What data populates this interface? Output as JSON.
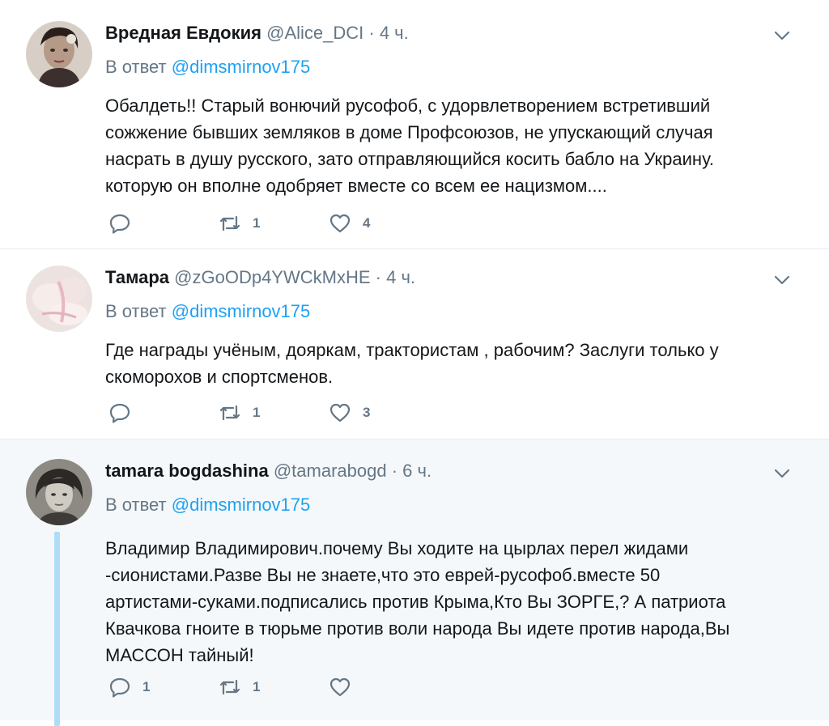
{
  "tweets": [
    {
      "name": "Вредная Евдокия",
      "handle": "@Alice_DCI",
      "dot": "·",
      "time": "4 ч.",
      "reply_prefix": "В ответ",
      "reply_to": "@dimsmirnov175",
      "text": "Обалдеть!! Старый вонючий русофоб, с удорвлетворением встретивший\nсожжение бывших земляков в доме Профсоюзов, не упускающий случая\nнасрать в душу русского, зато отправляющийся косить бабло на Украину.\nкоторую он вполне одобряет вместе со всем ее нацизмом....",
      "replies": "",
      "retweets": "1",
      "likes": "4"
    },
    {
      "name": "Тамара",
      "handle": "@zGoODp4YWCkMxHE",
      "dot": "·",
      "time": "4 ч.",
      "reply_prefix": "В ответ",
      "reply_to": "@dimsmirnov175",
      "text": "Где награды учёным,  дояркам, трактористам , рабочим? Заслуги только у\nскоморохов и спортсменов.",
      "replies": "",
      "retweets": "1",
      "likes": "3"
    },
    {
      "name": "tamara bogdashina",
      "handle": "@tamarabogd",
      "dot": "·",
      "time": "6 ч.",
      "reply_prefix": "В ответ",
      "reply_to": "@dimsmirnov175",
      "text": "Владимир Владимирович.почему Вы ходите на цырлах перел жидами\n-сионистами.Разве Вы не знаете,что это еврей-русофоб.вместе  50\nартистами-суками.подписались против Крыма,Кто Вы ЗОРГЕ,? А патриота\nКвачкова гноите в тюрьме против воли народа Вы идете против народа,Вы\nМАССОН тайный!",
      "replies": "1",
      "retweets": "1",
      "likes": ""
    }
  ],
  "icons": {
    "reply": "reply-icon",
    "retweet": "retweet-icon",
    "like": "heart-icon",
    "caret": "chevron-down-icon"
  },
  "colors": {
    "link": "#1da1f2",
    "secondary": "#657786",
    "thread_line": "#aedcf9",
    "highlight_bg": "#f5f8fa"
  }
}
